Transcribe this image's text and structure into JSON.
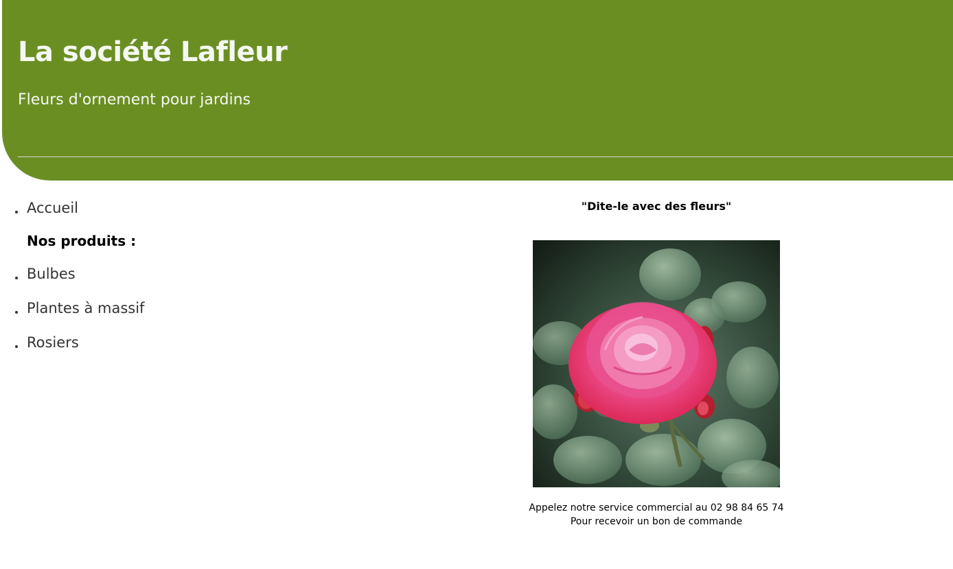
{
  "header": {
    "title": "La société Lafleur",
    "tagline": "Fleurs d'ornement pour jardins",
    "background_color": "#6b8e23"
  },
  "nav": {
    "home": "Accueil",
    "products_heading": "Nos produits :",
    "products": [
      "Bulbes",
      "Plantes à massif",
      "Rosiers"
    ]
  },
  "main": {
    "slogan": "\"Dite-le avec des fleurs\"",
    "contact_line1": "Appelez notre service commercial au 02 98 84 65 74",
    "contact_line2": "Pour recevoir un bon de commande",
    "photo_icon": "rose-photo"
  }
}
